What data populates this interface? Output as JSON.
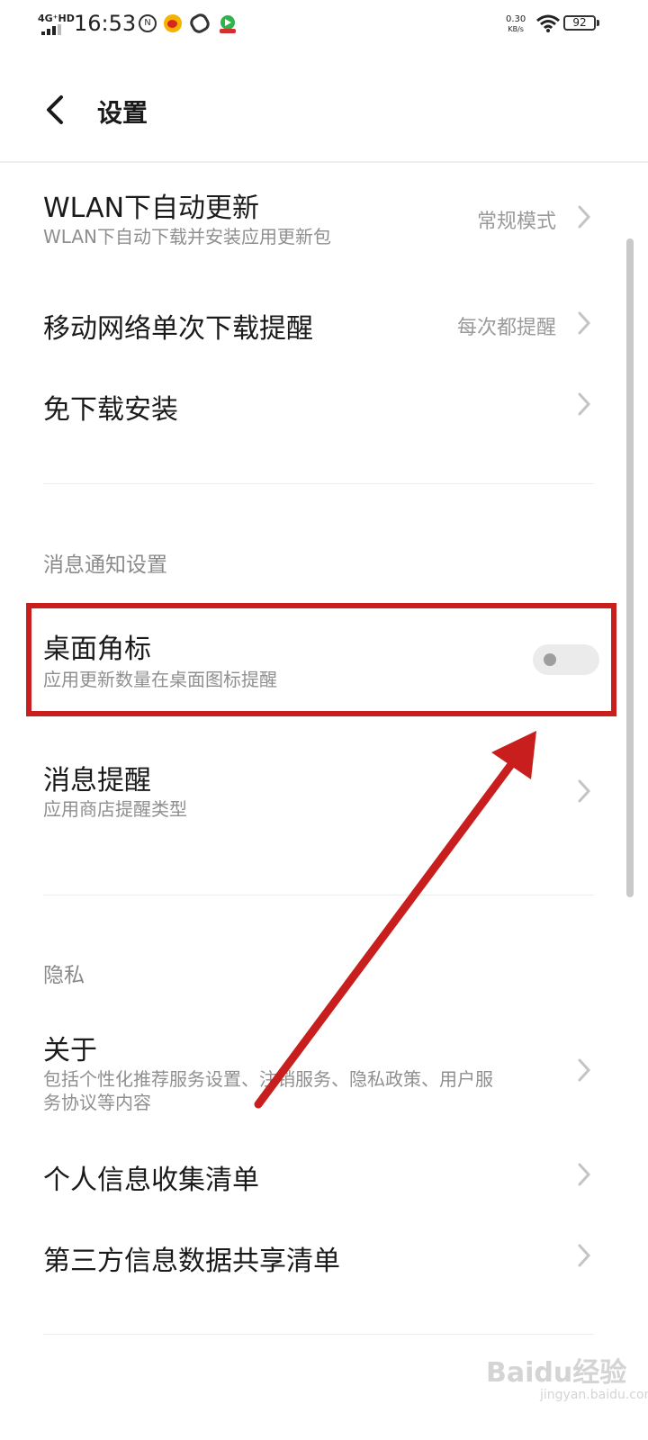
{
  "status_bar": {
    "network": "4G⁺HD",
    "time": "16:53",
    "speed_value": "0.30",
    "speed_unit": "KB/s",
    "battery": "92",
    "icons": [
      "nfc-icon",
      "weibo-icon",
      "link-icon",
      "video-app-icon",
      "wifi-icon",
      "signal-icon"
    ]
  },
  "header": {
    "title": "设置"
  },
  "items": [
    {
      "title": "WLAN下自动更新",
      "subtitle": "WLAN下自动下载并安装应用更新包",
      "value": "常规模式"
    },
    {
      "title": "移动网络单次下载提醒",
      "value": "每次都提醒"
    },
    {
      "title": "免下载安装"
    }
  ],
  "section_notifications": {
    "label": "消息通知设置",
    "badge": {
      "title": "桌面角标",
      "subtitle": "应用更新数量在桌面图标提醒",
      "enabled": false
    },
    "message": {
      "title": "消息提醒",
      "subtitle": "应用商店提醒类型"
    }
  },
  "section_privacy": {
    "label": "隐私",
    "about": {
      "title": "关于",
      "subtitle_line1": "包括个性化推荐服务设置、注销服务、隐私政策、用户服",
      "subtitle_line2": "务协议等内容"
    },
    "personal_info": {
      "title": "个人信息收集清单"
    },
    "third_party": {
      "title": "第三方信息数据共享清单"
    }
  },
  "annotation": {
    "color": "#c81e1e"
  },
  "watermark": {
    "text": "Baidu经验",
    "sub": "jingyan.baidu.com"
  }
}
